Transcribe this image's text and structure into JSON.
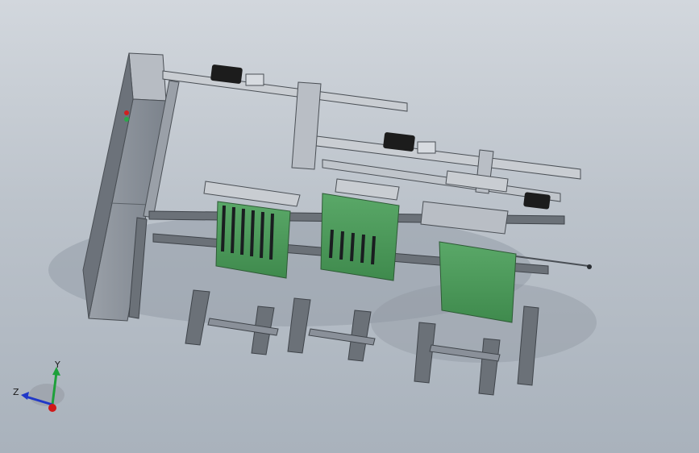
{
  "viewport": {
    "background_top": "#d2d7dd",
    "background_bottom": "#a9b2bc"
  },
  "model": {
    "frame_color": "#5f656c",
    "frame_highlight": "#d7dbe0",
    "belt_color": "#4e9a5c",
    "cabinet_color": "#8a9099",
    "motor_color": "#1c1c1c",
    "button_red": "#d02020",
    "button_green": "#2aa84a"
  },
  "triad": {
    "y_label": "Y",
    "z_label": "Z",
    "x_color": "#d01818",
    "y_color": "#1ea03a",
    "z_color": "#2038c8"
  }
}
